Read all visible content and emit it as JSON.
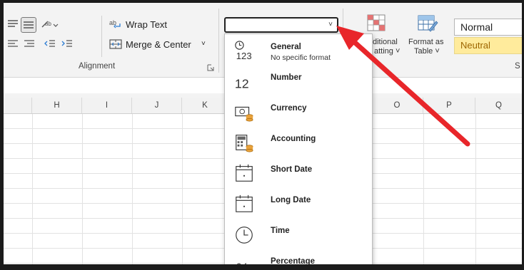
{
  "ribbon": {
    "wrap_text": "Wrap Text",
    "merge_center": "Merge & Center",
    "alignment_group": "Alignment",
    "conditional_line1": "ditional",
    "conditional_line2": "atting ˅",
    "format_table_line1": "Format as",
    "format_table_line2": "Table ˅",
    "style_normal": "Normal",
    "style_neutral": "Neutral",
    "style_group_partial": "S",
    "number_format_value": ""
  },
  "columns": [
    "H",
    "I",
    "J",
    "K",
    "O",
    "P",
    "Q"
  ],
  "number_format_menu": [
    {
      "title": "General",
      "subtitle": "No specific format",
      "icon": "general-123-icon"
    },
    {
      "title": "Number",
      "subtitle": "",
      "icon": "number-12-icon"
    },
    {
      "title": "Currency",
      "subtitle": "",
      "icon": "currency-icon"
    },
    {
      "title": "Accounting",
      "subtitle": "",
      "icon": "accounting-icon"
    },
    {
      "title": "Short Date",
      "subtitle": "",
      "icon": "short-date-icon"
    },
    {
      "title": "Long Date",
      "subtitle": "",
      "icon": "long-date-icon"
    },
    {
      "title": "Time",
      "subtitle": "",
      "icon": "time-clock-icon"
    },
    {
      "title": "Percentage",
      "subtitle": "",
      "icon": "percentage-icon"
    }
  ],
  "icon_glyphs": {
    "general": "123",
    "number": "12",
    "percentage": "%"
  },
  "colors": {
    "annotation_arrow": "#e8262a",
    "neutral_fill": "#ffeb9c",
    "neutral_text": "#9c6500"
  }
}
